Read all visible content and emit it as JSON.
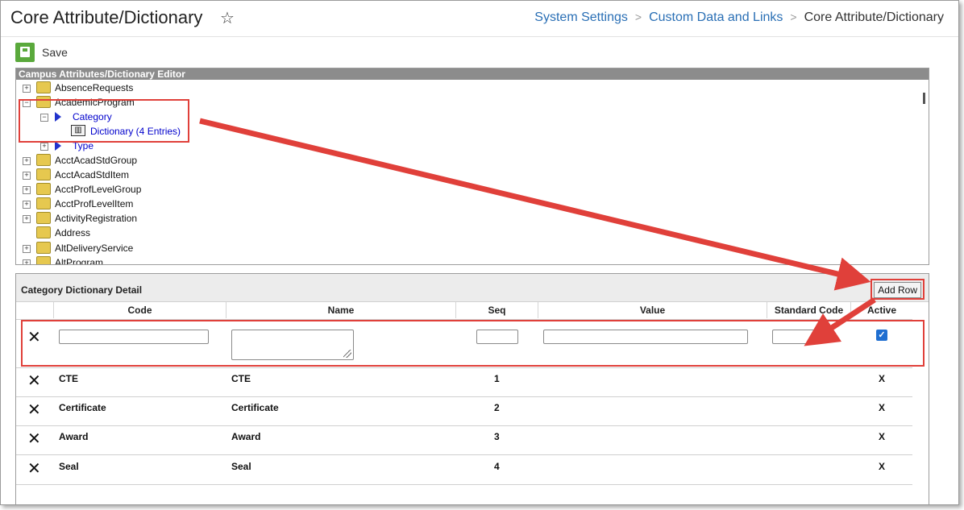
{
  "header": {
    "title": "Core Attribute/Dictionary",
    "breadcrumb": [
      "System Settings",
      "Custom Data and Links",
      "Core Attribute/Dictionary"
    ]
  },
  "toolbar": {
    "save_label": "Save"
  },
  "tree": {
    "title": "Campus Attributes/Dictionary Editor",
    "items": [
      {
        "label": "AbsenceRequests"
      },
      {
        "label": "AcademicProgram"
      },
      {
        "label": "Category"
      },
      {
        "label": "Dictionary (4 Entries)"
      },
      {
        "label": "Type"
      },
      {
        "label": "AcctAcadStdGroup"
      },
      {
        "label": "AcctAcadStdItem"
      },
      {
        "label": "AcctProfLevelGroup"
      },
      {
        "label": "AcctProfLevelItem"
      },
      {
        "label": "ActivityRegistration"
      },
      {
        "label": "Address"
      },
      {
        "label": "AltDeliveryService"
      },
      {
        "label": "AltProgram"
      }
    ]
  },
  "detail": {
    "title": "Category Dictionary Detail",
    "add_row_label": "Add Row",
    "columns": [
      "Code",
      "Name",
      "Seq",
      "Value",
      "Standard Code",
      "Active"
    ],
    "rows": [
      {
        "code": "CTE",
        "name": "CTE",
        "seq": "1",
        "active": "X"
      },
      {
        "code": "Certificate",
        "name": "Certificate",
        "seq": "2",
        "active": "X"
      },
      {
        "code": "Award",
        "name": "Award",
        "seq": "3",
        "active": "X"
      },
      {
        "code": "Seal",
        "name": "Seal",
        "seq": "4",
        "active": "X"
      }
    ]
  },
  "colors": {
    "accent_red": "#e0403a",
    "link_blue": "#2a6fb5",
    "save_green": "#5aa93c"
  }
}
